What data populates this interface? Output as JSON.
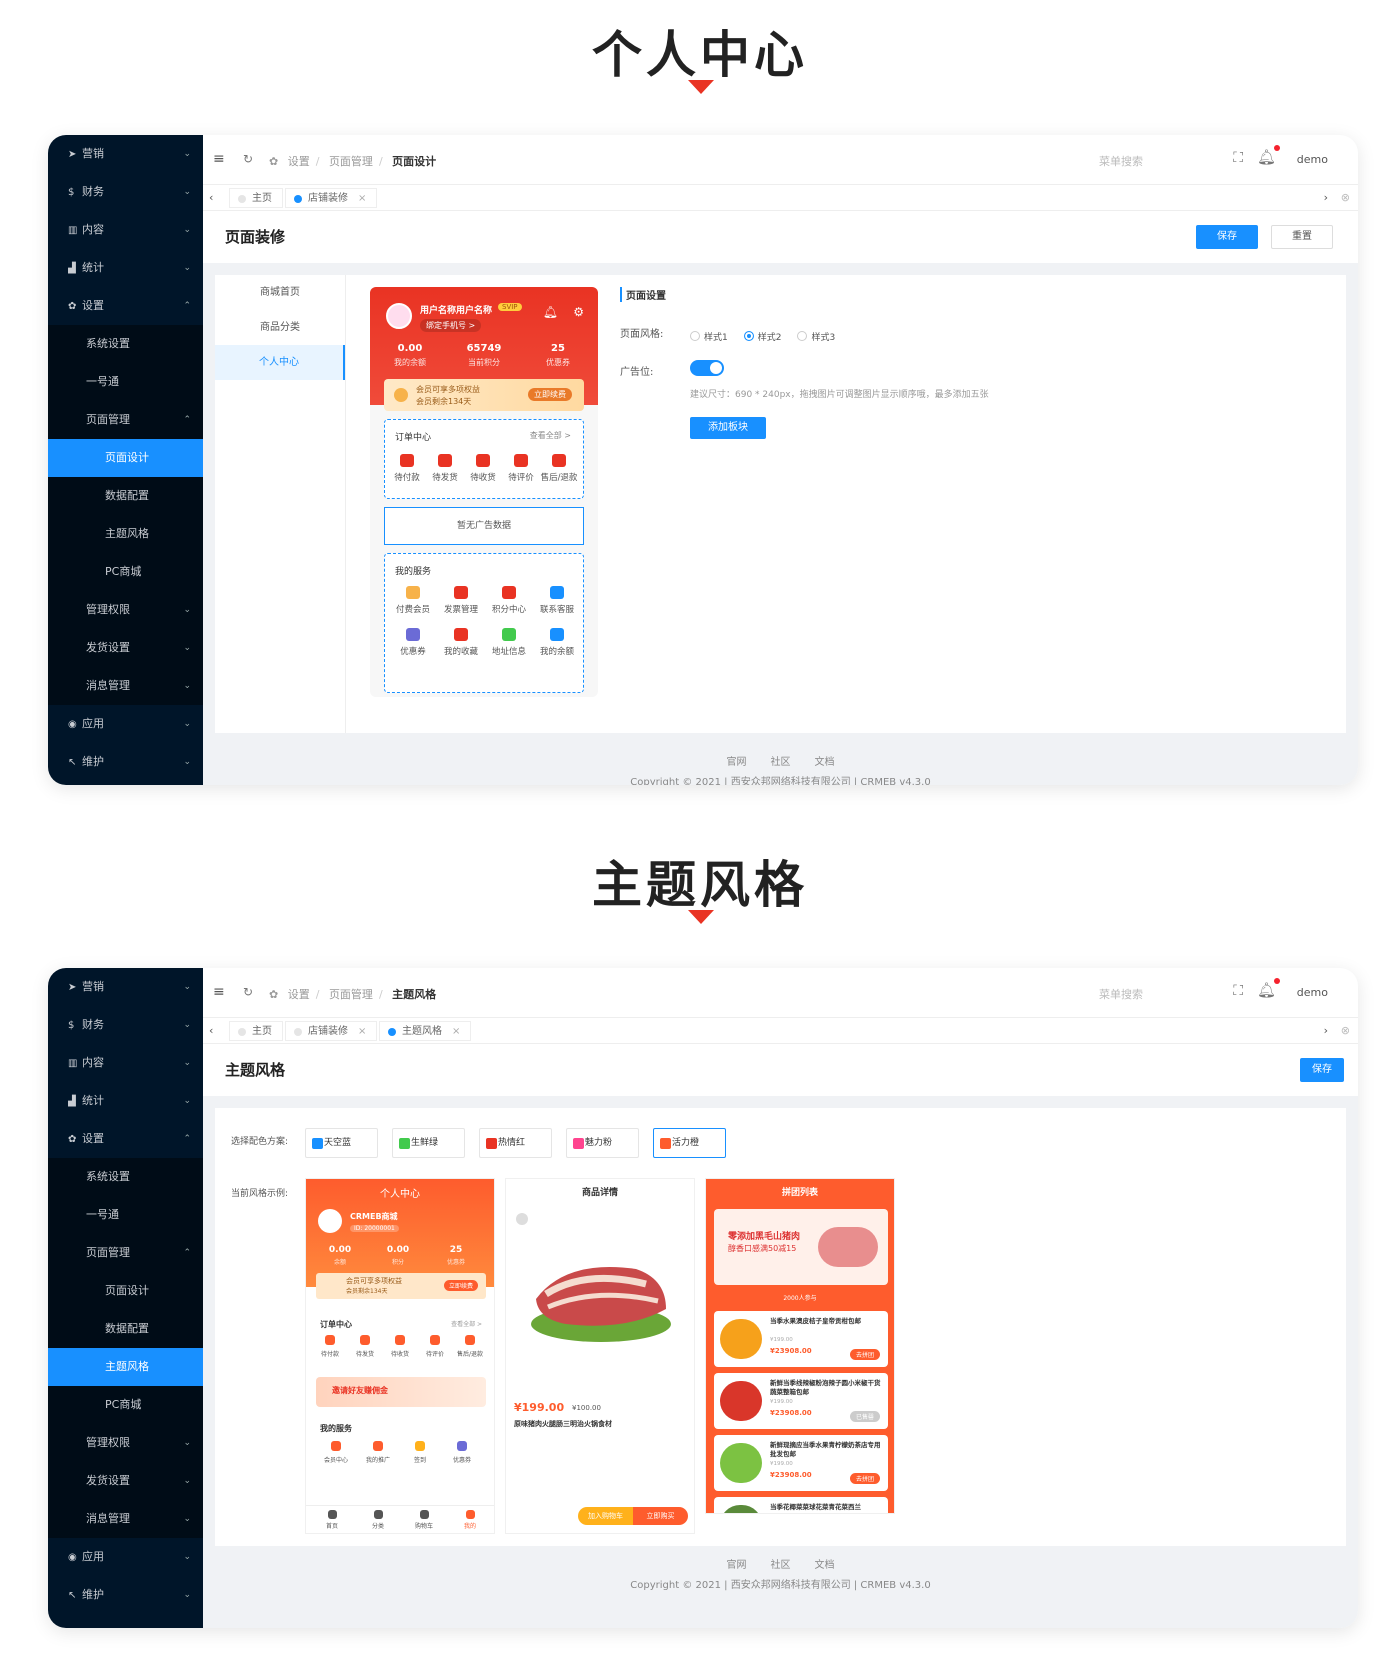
{
  "section1": {
    "title": "个人中心"
  },
  "section2": {
    "title": "主题风格"
  },
  "sidebar1": {
    "items": [
      {
        "label": "营销",
        "icon": "send-icon",
        "level": 0
      },
      {
        "label": "财务",
        "icon": "dollar-icon",
        "level": 0
      },
      {
        "label": "内容",
        "icon": "book-icon",
        "level": 0
      },
      {
        "label": "统计",
        "icon": "chart-icon",
        "level": 0
      },
      {
        "label": "设置",
        "icon": "gear-icon",
        "level": 0,
        "open": true
      },
      {
        "label": "系统设置",
        "level": 1
      },
      {
        "label": "一号通",
        "level": 1
      },
      {
        "label": "页面管理",
        "level": 1,
        "open": true
      },
      {
        "label": "页面设计",
        "level": 2,
        "active": true
      },
      {
        "label": "数据配置",
        "level": 2
      },
      {
        "label": "主题风格",
        "level": 2
      },
      {
        "label": "PC商城",
        "level": 2
      },
      {
        "label": "管理权限",
        "level": 1
      },
      {
        "label": "发货设置",
        "level": 1
      },
      {
        "label": "消息管理",
        "level": 1
      },
      {
        "label": "应用",
        "icon": "app-icon",
        "level": 0
      },
      {
        "label": "维护",
        "icon": "wrench-icon",
        "level": 0
      }
    ]
  },
  "sidebar2": {
    "items": [
      {
        "label": "营销",
        "icon": "send-icon",
        "level": 0
      },
      {
        "label": "财务",
        "icon": "dollar-icon",
        "level": 0
      },
      {
        "label": "内容",
        "icon": "book-icon",
        "level": 0
      },
      {
        "label": "统计",
        "icon": "chart-icon",
        "level": 0
      },
      {
        "label": "设置",
        "icon": "gear-icon",
        "level": 0,
        "open": true
      },
      {
        "label": "系统设置",
        "level": 1
      },
      {
        "label": "一号通",
        "level": 1
      },
      {
        "label": "页面管理",
        "level": 1,
        "open": true
      },
      {
        "label": "页面设计",
        "level": 2
      },
      {
        "label": "数据配置",
        "level": 2
      },
      {
        "label": "主题风格",
        "level": 2,
        "active": true
      },
      {
        "label": "PC商城",
        "level": 2
      },
      {
        "label": "管理权限",
        "level": 1
      },
      {
        "label": "发货设置",
        "level": 1
      },
      {
        "label": "消息管理",
        "level": 1
      },
      {
        "label": "应用",
        "icon": "app-icon",
        "level": 0
      },
      {
        "label": "维护",
        "icon": "wrench-icon",
        "level": 0
      }
    ]
  },
  "topbar": {
    "crumb1": "设置",
    "crumb2": "页面管理",
    "crumb3_a": "页面设计",
    "crumb3_b": "主题风格",
    "search_placeholder": "菜单搜索",
    "user": "demo"
  },
  "tabs1": {
    "home": "主页",
    "t1": "店铺装修"
  },
  "tabs2": {
    "home": "主页",
    "t1": "店铺装修",
    "t2": "主题风格"
  },
  "screen1": {
    "title": "页面装修",
    "save": "保存",
    "reset": "重置",
    "leftnav": [
      "商城首页",
      "商品分类",
      "个人中心"
    ],
    "phone": {
      "username": "用户名称用户名称",
      "vip": "SVIP",
      "bind": "绑定手机号 >",
      "stats": [
        {
          "value": "0.00",
          "label": "我的余额"
        },
        {
          "value": "65749",
          "label": "当前积分"
        },
        {
          "value": "25",
          "label": "优惠券"
        }
      ],
      "member_text1": "会员可享多项权益",
      "member_text2": "会员剩余134天",
      "renew": "立即续费",
      "order_title": "订单中心",
      "order_all": "查看全部 >",
      "orders": [
        "待付款",
        "待发货",
        "待收货",
        "待评价",
        "售后/退款"
      ],
      "ad_empty": "暂无广告数据",
      "service_title": "我的服务",
      "services": [
        "付费会员",
        "发票管理",
        "积分中心",
        "联系客服",
        "优惠券",
        "我的收藏",
        "地址信息",
        "我的余额"
      ]
    },
    "settings": {
      "title": "页面设置",
      "style_label": "页面风格:",
      "styles": [
        "样式1",
        "样式2",
        "样式3"
      ],
      "ad_label": "广告位:",
      "hint": "建议尺寸：690 * 240px，拖拽图片可调整图片显示顺序哦，最多添加五张",
      "add_btn": "添加板块"
    },
    "footer_links": [
      "官网",
      "社区",
      "文档"
    ],
    "copyright": "Copyright © 2021 | 西安众邦网络科技有限公司 | CRMEB v4.3.0"
  },
  "screen2": {
    "title": "主题风格",
    "save": "保存",
    "scheme_label": "选择配色方案:",
    "schemes": [
      {
        "name": "天空蓝",
        "color": "#1890ff"
      },
      {
        "name": "生鲜绿",
        "color": "#42ca4d"
      },
      {
        "name": "热情红",
        "color": "#e93323"
      },
      {
        "name": "魅力粉",
        "color": "#ff448f"
      },
      {
        "name": "活力橙",
        "color": "#fe5c2d"
      }
    ],
    "example_label": "当前风格示例:",
    "card1": {
      "title": "个人中心",
      "shop": "CRMEB商城",
      "id": "ID: 20000001",
      "stats": [
        {
          "value": "0.00",
          "label": "余额"
        },
        {
          "value": "0.00",
          "label": "积分"
        },
        {
          "value": "25",
          "label": "优惠券"
        }
      ],
      "member": "会员可享多项权益",
      "member2": "会员剩余134天",
      "renew": "立即续费",
      "order_title": "订单中心",
      "order_all": "查看全部 >",
      "orders": [
        "待付款",
        "待发货",
        "待收货",
        "待评价",
        "售后/退款"
      ],
      "banner": "邀请好友赚佣金",
      "service_title": "我的服务",
      "services": [
        "会员中心",
        "我的推广",
        "签到",
        "优惠券"
      ],
      "tabbar": [
        "首页",
        "分类",
        "购物车",
        "我的"
      ]
    },
    "card2": {
      "title": "商品详情",
      "price": "¥199.00",
      "orig": "¥100.00",
      "name": "原味猪肉火腿肠三明治火锅食材",
      "tags": [
        "加入购物车",
        "立即购买"
      ]
    },
    "card3": {
      "title": "拼团列表",
      "banner1": "零添加黑毛山猪肉",
      "banner2": "醇香口感满50减15",
      "count": "2000人参与",
      "items": [
        {
          "name": "当季水果澳皮桔子皇帝贡柑包邮",
          "price": "¥23908.00",
          "old": "¥199.00",
          "btn": "去拼团"
        },
        {
          "name": "新鲜当季线辣椒粉泡辣子圆小米椒干货蔬菜整箱包邮",
          "price": "¥23908.00",
          "old": "¥199.00",
          "btn": "已售罄"
        },
        {
          "name": "新鲜现摘应当季水果青柠檬奶茶店专用批发包邮",
          "price": "¥23908.00",
          "old": "¥199.00",
          "btn": "去拼团"
        },
        {
          "name": "当季花椰菜菜球花菜青花菜西兰",
          "price": "",
          "old": "",
          "btn": ""
        }
      ]
    },
    "footer_links": [
      "官网",
      "社区",
      "文档"
    ],
    "copyright": "Copyright © 2021 | 西安众邦网络科技有限公司 | CRMEB v4.3.0"
  }
}
